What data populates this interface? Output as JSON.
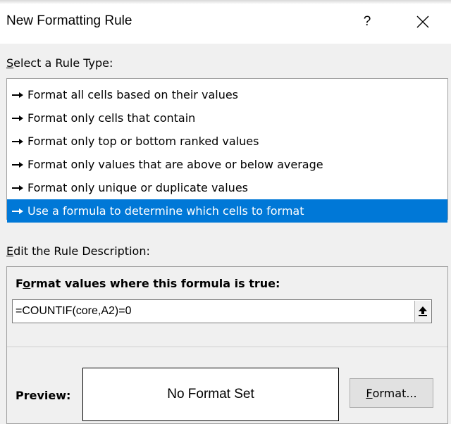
{
  "dialog": {
    "title": "New Formatting Rule",
    "help_label": "?"
  },
  "rule_type": {
    "label_accel": "S",
    "label_rest": "elect a Rule Type:",
    "items": [
      {
        "label": "Format all cells based on their values"
      },
      {
        "label": "Format only cells that contain"
      },
      {
        "label": "Format only top or bottom ranked values"
      },
      {
        "label": "Format only values that are above or below average"
      },
      {
        "label": "Format only unique or duplicate values"
      },
      {
        "label": "Use a formula to determine which cells to format"
      }
    ],
    "selected_index": 5
  },
  "description": {
    "label_accel": "E",
    "label_rest": "dit the Rule Description:",
    "formula_label_pre": "F",
    "formula_label_accel": "o",
    "formula_label_rest": "rmat values where this formula is true:",
    "formula_value": "=COUNTIF(core,A2)=0"
  },
  "preview": {
    "label": "Preview:",
    "text": "No Format Set"
  },
  "format_button": {
    "accel": "F",
    "rest": "ormat..."
  },
  "colors": {
    "selection": "#0078d7",
    "dialog_bg": "#f0f0f0"
  },
  "icons": {
    "close": "close-icon",
    "collapse": "collapse-dialog-icon",
    "bullet": "arrow-bullet-icon"
  }
}
